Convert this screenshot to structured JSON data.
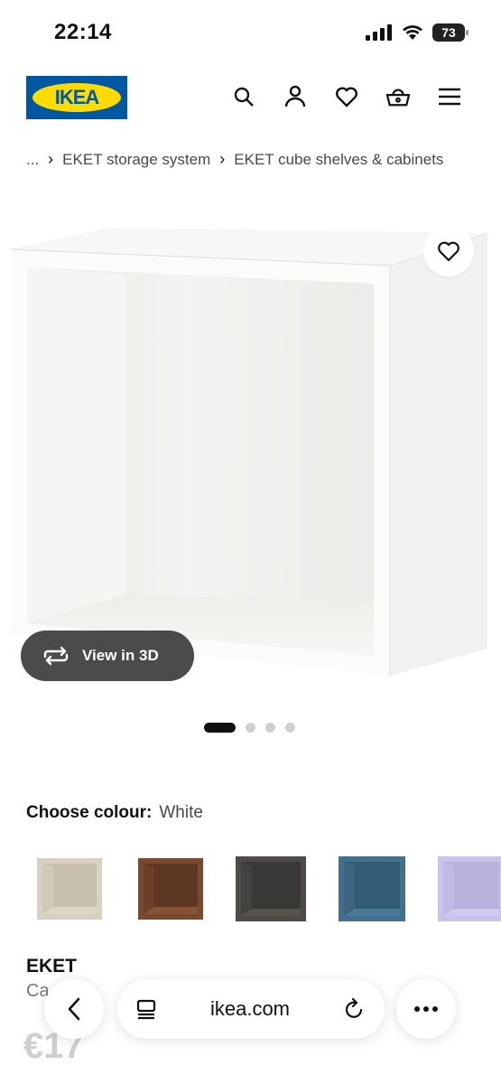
{
  "status_bar": {
    "time": "22:14",
    "battery": "73"
  },
  "header": {
    "logo_text": "IKEA",
    "icons": [
      "search-icon",
      "profile-icon",
      "heart-icon",
      "basket-icon",
      "menu-icon"
    ]
  },
  "breadcrumb": {
    "items": [
      "...",
      "EKET storage system",
      "EKET cube shelves & cabinets"
    ],
    "separator": "›"
  },
  "gallery": {
    "view3d_label": "View in 3D",
    "pager": {
      "count": 4,
      "active": 0
    }
  },
  "colour": {
    "label": "Choose colour:",
    "selected": "White",
    "options": [
      {
        "color": "#d7d1c1"
      },
      {
        "color": "#7a4a30"
      },
      {
        "color": "#4e4b48"
      },
      {
        "color": "#43708d"
      },
      {
        "color": "#c9c3ea"
      }
    ]
  },
  "product": {
    "name": "EKET",
    "description": "Ca",
    "price": "€17"
  },
  "browser": {
    "url": "ikea.com"
  },
  "colors": {
    "ikea_blue": "#0058a3",
    "ikea_yellow": "#ffdb00"
  }
}
